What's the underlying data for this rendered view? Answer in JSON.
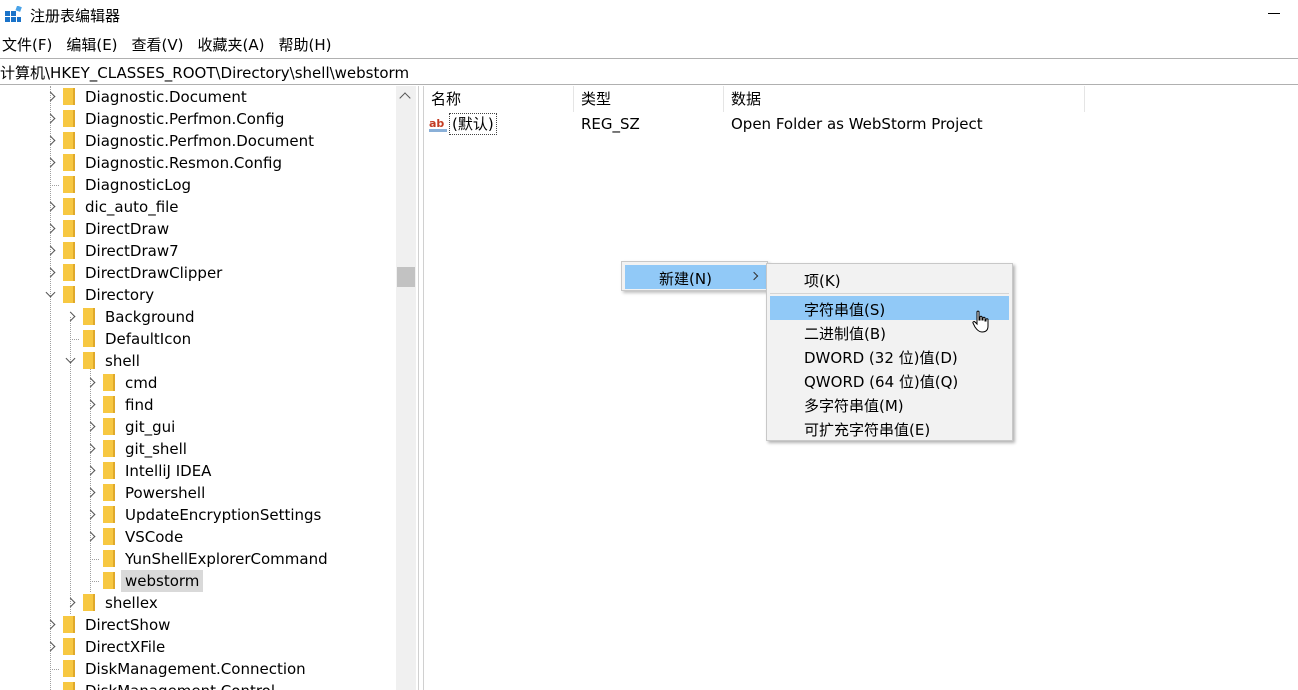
{
  "window": {
    "title": "注册表编辑器"
  },
  "menubar": [
    "文件(F)",
    "编辑(E)",
    "查看(V)",
    "收藏夹(A)",
    "帮助(H)"
  ],
  "address": "计算机\\HKEY_CLASSES_ROOT\\Directory\\shell\\webstorm",
  "tree": {
    "items": [
      {
        "label": "Diagnostic.Document",
        "level": 1,
        "expander": "closed"
      },
      {
        "label": "Diagnostic.Perfmon.Config",
        "level": 1,
        "expander": "closed"
      },
      {
        "label": "Diagnostic.Perfmon.Document",
        "level": 1,
        "expander": "closed"
      },
      {
        "label": "Diagnostic.Resmon.Config",
        "level": 1,
        "expander": "closed"
      },
      {
        "label": "DiagnosticLog",
        "level": 1,
        "expander": "none"
      },
      {
        "label": "dic_auto_file",
        "level": 1,
        "expander": "closed"
      },
      {
        "label": "DirectDraw",
        "level": 1,
        "expander": "closed"
      },
      {
        "label": "DirectDraw7",
        "level": 1,
        "expander": "closed"
      },
      {
        "label": "DirectDrawClipper",
        "level": 1,
        "expander": "closed"
      },
      {
        "label": "Directory",
        "level": 1,
        "expander": "open"
      },
      {
        "label": "Background",
        "level": 2,
        "expander": "closed"
      },
      {
        "label": "DefaultIcon",
        "level": 2,
        "expander": "none"
      },
      {
        "label": "shell",
        "level": 2,
        "expander": "open"
      },
      {
        "label": "cmd",
        "level": 3,
        "expander": "closed"
      },
      {
        "label": "find",
        "level": 3,
        "expander": "closed"
      },
      {
        "label": "git_gui",
        "level": 3,
        "expander": "closed"
      },
      {
        "label": "git_shell",
        "level": 3,
        "expander": "closed"
      },
      {
        "label": "IntelliJ IDEA",
        "level": 3,
        "expander": "closed"
      },
      {
        "label": "Powershell",
        "level": 3,
        "expander": "closed"
      },
      {
        "label": "UpdateEncryptionSettings",
        "level": 3,
        "expander": "closed"
      },
      {
        "label": "VSCode",
        "level": 3,
        "expander": "closed"
      },
      {
        "label": "YunShellExplorerCommand",
        "level": 3,
        "expander": "none"
      },
      {
        "label": "webstorm",
        "level": 3,
        "expander": "none",
        "selected": true
      },
      {
        "label": "shellex",
        "level": 2,
        "expander": "closed"
      },
      {
        "label": "DirectShow",
        "level": 1,
        "expander": "closed"
      },
      {
        "label": "DirectXFile",
        "level": 1,
        "expander": "closed"
      },
      {
        "label": "DiskManagement.Connection",
        "level": 1,
        "expander": "none"
      },
      {
        "label": "DiskManagement.Control",
        "level": 1,
        "expander": "none"
      }
    ]
  },
  "values": {
    "headers": {
      "name": "名称",
      "type": "类型",
      "data": "数据"
    },
    "rows": [
      {
        "icon": "string-value-icon",
        "icon_text": "ab",
        "name": "(默认)",
        "type": "REG_SZ",
        "data": "Open Folder as WebStorm Project"
      }
    ]
  },
  "context_menu": {
    "item": "新建(N)",
    "submenu": [
      "项(K)",
      "字符串值(S)",
      "二进制值(B)",
      "DWORD (32 位)值(D)",
      "QWORD (64 位)值(Q)",
      "多字符串值(M)",
      "可扩充字符串值(E)"
    ],
    "highlighted": "字符串值(S)"
  },
  "colors": {
    "highlight": "#91c9f7",
    "selection": "#d9d9d9",
    "folder": "#f7c842"
  }
}
